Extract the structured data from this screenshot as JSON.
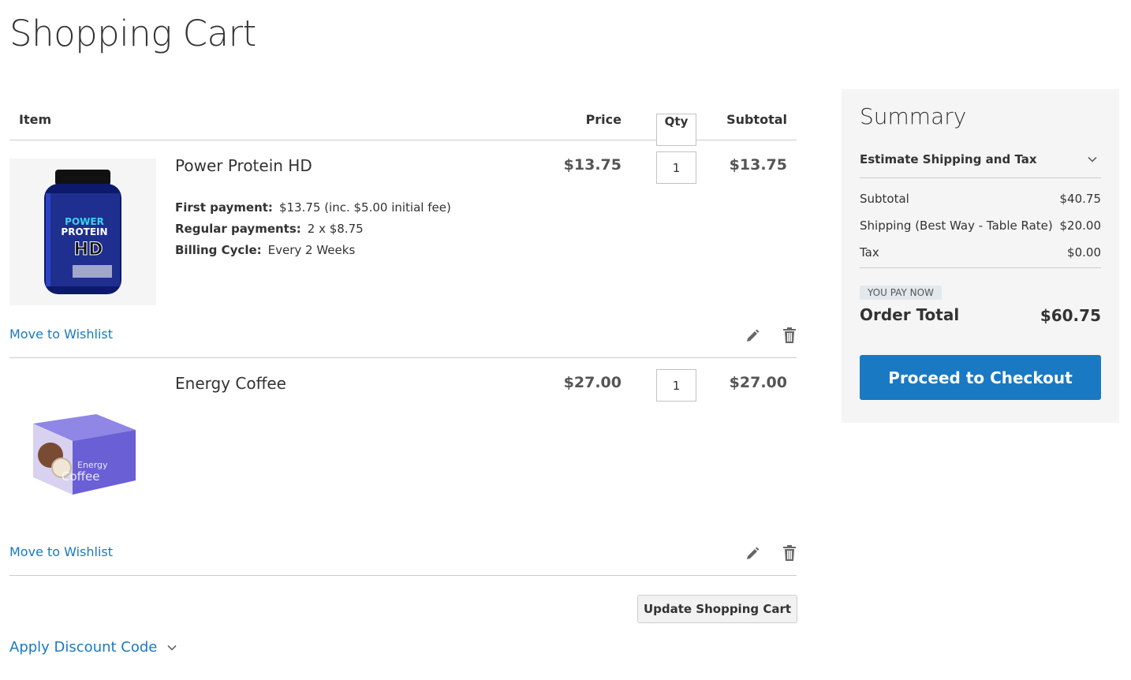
{
  "page": {
    "title": "Shopping Cart"
  },
  "cart": {
    "headers": {
      "item": "Item",
      "price": "Price",
      "qty": "Qty",
      "subtotal": "Subtotal"
    },
    "items": [
      {
        "name": "Power Protein HD",
        "price": "$13.75",
        "qty": "1",
        "subtotal": "$13.75",
        "image_icon": "protein-jar-image",
        "image_label_1": "POWER",
        "image_label_2": "PROTEIN",
        "image_label_3": "HD",
        "options": [
          {
            "label": "First payment:",
            "value": "$13.75 (inc. $5.00 initial fee)"
          },
          {
            "label": "Regular payments:",
            "value": "2 x $8.75"
          },
          {
            "label": "Billing Cycle:",
            "value": "Every 2 Weeks"
          }
        ],
        "wishlist_label": "Move to Wishlist"
      },
      {
        "name": "Energy Coffee",
        "price": "$27.00",
        "qty": "1",
        "subtotal": "$27.00",
        "image_icon": "coffee-box-image",
        "image_label_1": "Energy",
        "image_label_2": "Coffee",
        "wishlist_label": "Move to Wishlist"
      }
    ],
    "update_label": "Update Shopping Cart",
    "discount_label": "Apply Discount Code"
  },
  "summary": {
    "title": "Summary",
    "estimate_label": "Estimate Shipping and Tax",
    "rows": [
      {
        "label": "Subtotal",
        "value": "$40.75"
      },
      {
        "label": "Shipping (Best Way - Table Rate)",
        "value": "$20.00"
      },
      {
        "label": "Tax",
        "value": "$0.00"
      }
    ],
    "pay_now_label": "YOU PAY NOW",
    "order_total_label": "Order Total",
    "order_total_value": "$60.75",
    "checkout_label": "Proceed to Checkout"
  },
  "colors": {
    "accent": "#1979c3",
    "summary_bg": "#f5f5f5",
    "protein_jar": "#1e2f8f",
    "coffee_box": "#6b5fd6"
  }
}
